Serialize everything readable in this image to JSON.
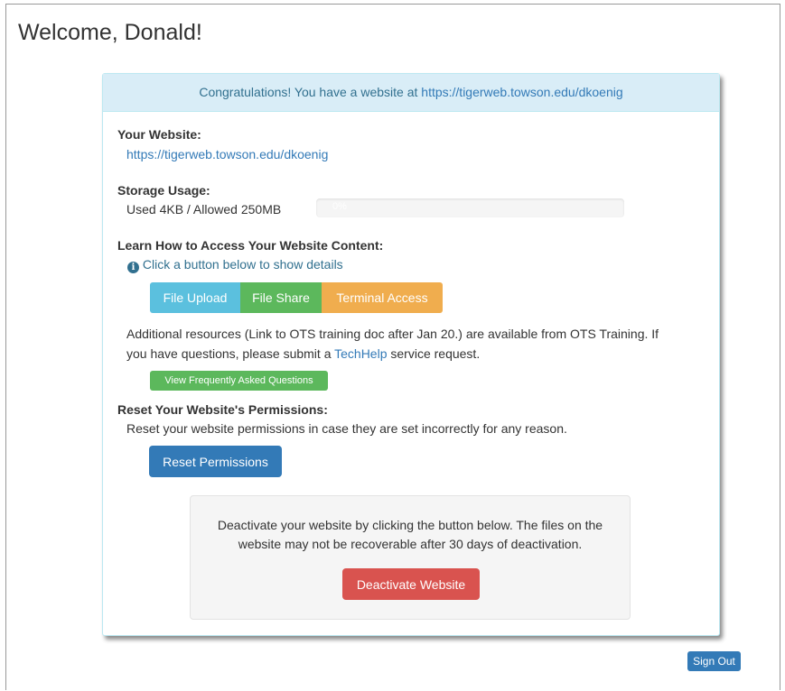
{
  "page": {
    "welcome": "Welcome, Donald!"
  },
  "panel": {
    "heading_text": "Congratulations! You have a website at ",
    "heading_link": "https://tigerweb.towson.edu/dkoenig",
    "website_label": "Your Website:",
    "website_url": "https://tigerweb.towson.edu/dkoenig",
    "storage_label": "Storage Usage:",
    "storage_text": "Used 4KB / Allowed 250MB",
    "storage_percent_text": "0%",
    "storage_percent": 0,
    "learn_label": "Learn How to Access Your Website Content:",
    "learn_hint": "Click a button below to show details",
    "buttons": {
      "file_upload": "File Upload",
      "file_share": "File Share",
      "terminal_access": "Terminal Access"
    },
    "resources_text_1": "Additional resources (Link to OTS training doc after Jan 20.) are available from OTS Training. If",
    "resources_text_2_a": "you have questions, please submit a ",
    "resources_link": "TechHelp",
    "resources_text_2_b": " service request.",
    "faq_button": "View Frequently Asked Questions",
    "reset_label": "Reset Your Website's Permissions:",
    "reset_text": "Reset your website permissions in case they are set incorrectly for any reason.",
    "reset_button": "Reset Permissions",
    "deactivate_text_1": "Deactivate your website by clicking the button below. The files on the",
    "deactivate_text_2": "website may not be recoverable after 30 days of deactivation.",
    "deactivate_button": "Deactivate Website"
  },
  "footer": {
    "sign_out": "Sign Out"
  },
  "colors": {
    "info": "#5bc0de",
    "success": "#5cb85c",
    "warning": "#f0ad4e",
    "primary": "#337ab7",
    "danger": "#d9534f"
  },
  "icons": {
    "info": "info-circle-icon"
  }
}
